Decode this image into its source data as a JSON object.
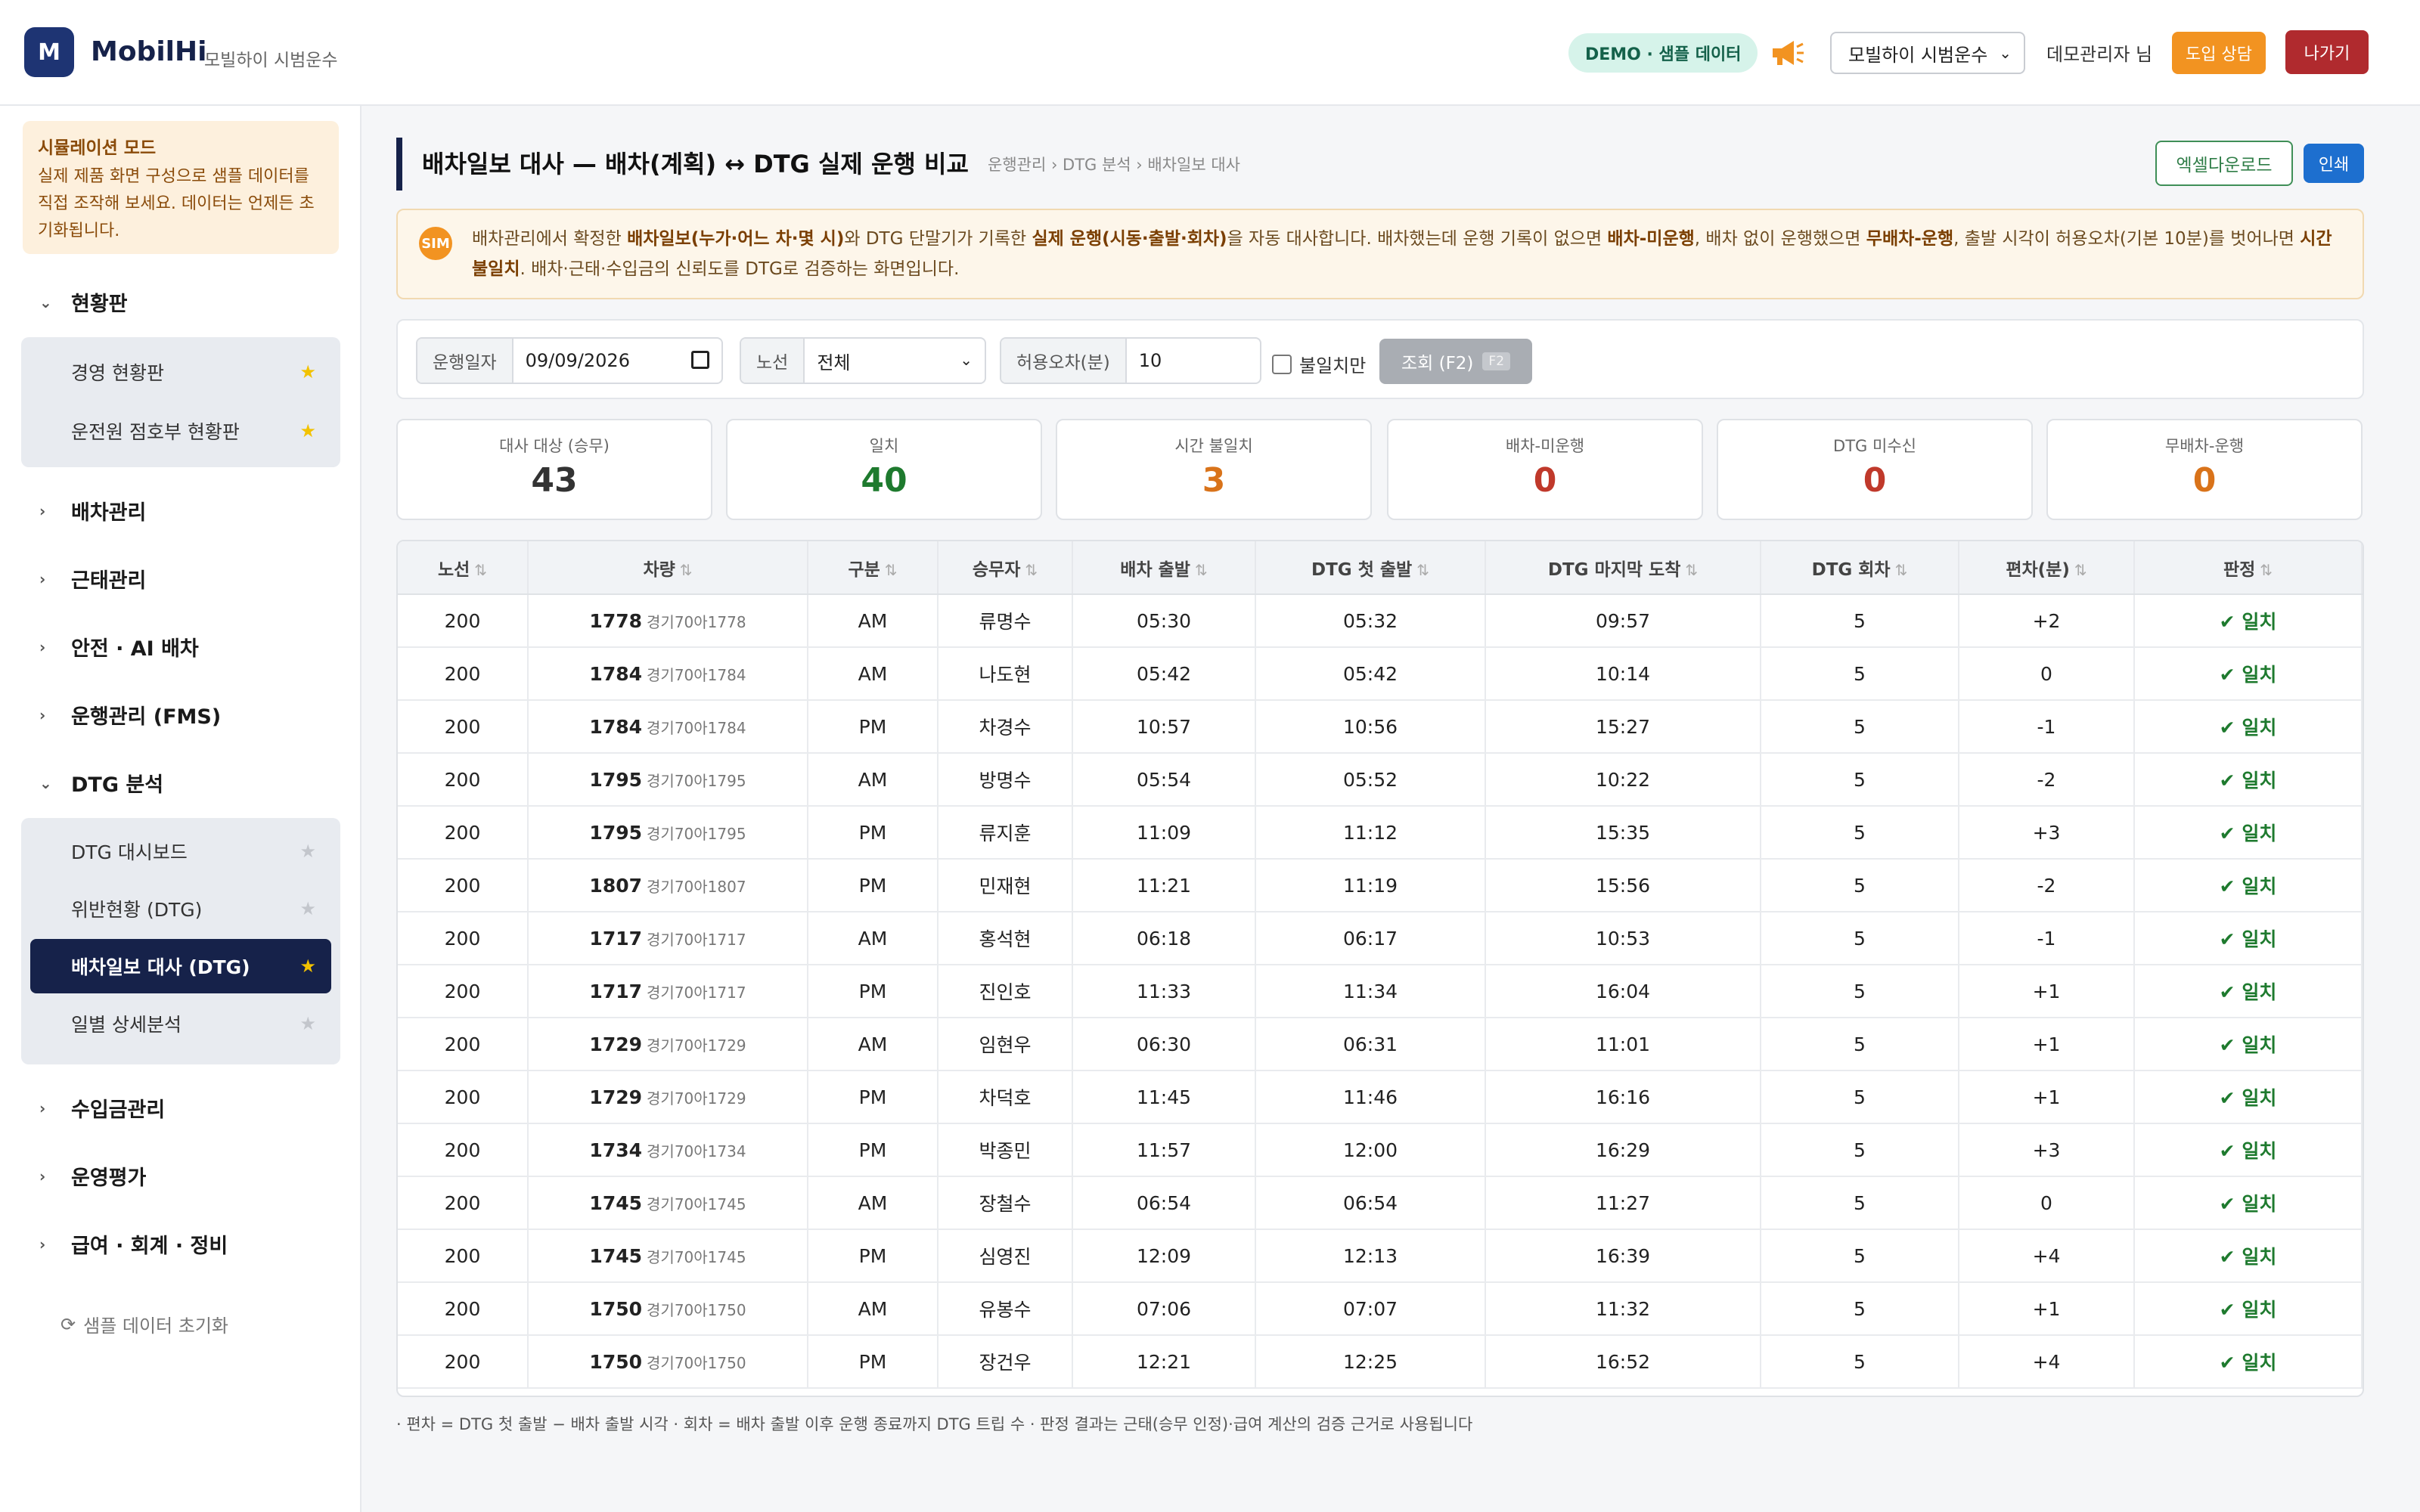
{
  "header": {
    "logo_letter": "M",
    "brand": "MobilHi",
    "brand_sub": "모빌하이 시범운수",
    "demo_badge": "DEMO · 샘플 데이터",
    "org_select": "모빌하이 시범운수",
    "user": "데모관리자 님",
    "consult_label": "도입 상담",
    "exit_label": "나가기"
  },
  "sidebar": {
    "sim_title": "시뮬레이션 모드",
    "sim_text": "실제 제품 화면 구성으로 샘플 데이터를 직접 조작해 보세요. 데이터는 언제든 초기화됩니다.",
    "groups": {
      "dashboard": "현황판",
      "dispatch": "배차관리",
      "attendance": "근태관리",
      "safety": "안전 · AI 배차",
      "fms": "운행관리 (FMS)",
      "dtg": "DTG 분석",
      "revenue": "수입금관리",
      "evaluation": "운영평가",
      "payroll": "급여 · 회계 · 정비"
    },
    "dashboard_items": [
      "경영 현황판",
      "운전원 점호부 현황판"
    ],
    "dtg_items": [
      "DTG 대시보드",
      "위반현황 (DTG)",
      "배차일보 대사 (DTG)",
      "일별 상세분석"
    ],
    "reset_label": "샘플 데이터 초기화"
  },
  "main": {
    "title": "배차일보 대사 — 배차(계획) ↔ DTG 실제 운행 비교",
    "breadcrumb": "운행관리 › DTG 분석 › 배차일보 대사",
    "excel_label": "엑셀다운로드",
    "print_label": "인쇄",
    "sim_badge": "SIM",
    "info": {
      "p1": "배차관리에서 확정한 ",
      "b1": "배차일보(누가·어느 차·몇 시)",
      "p2": "와 DTG 단말기가 기록한 ",
      "b2": "실제 운행(시동·출발·회차)",
      "p3": "을 자동 대사합니다. 배차했는데 운행 기록이 없으면 ",
      "b3": "배차-미운행",
      "p4": ", 배차 없이 운행했으면 ",
      "b4": "무배차-운행",
      "p5": ", 출발 시각이 허용오차(기본 10분)를 벗어나면 ",
      "b5": "시간 불일치",
      "p6": ". 배차·근태·수입금의 신뢰도를 DTG로 검증하는 화면입니다."
    },
    "filters": {
      "date_label": "운행일자",
      "date_value": "09/09/2026",
      "route_label": "노선",
      "route_value": "전체",
      "tolerance_label": "허용오차(분)",
      "tolerance_value": "10",
      "mismatch_only": "불일치만",
      "query_label": "조회 (F2)",
      "query_key": "F2"
    },
    "stats": [
      {
        "label": "대사 대상 (승무)",
        "value": "43",
        "color": "#333333"
      },
      {
        "label": "일치",
        "value": "40",
        "color": "#1e7a2e"
      },
      {
        "label": "시간 불일치",
        "value": "3",
        "color": "#d9731a"
      },
      {
        "label": "배차-미운행",
        "value": "0",
        "color": "#c0392b"
      },
      {
        "label": "DTG 미수신",
        "value": "0",
        "color": "#c0392b"
      },
      {
        "label": "무배차-운행",
        "value": "0",
        "color": "#d9731a"
      }
    ],
    "table": {
      "headers": [
        "노선",
        "차량",
        "구분",
        "승무자",
        "배차 출발",
        "DTG 첫 출발",
        "DTG 마지막 도착",
        "DTG 회차",
        "편차(분)",
        "판정"
      ],
      "sort_icon": "⇅",
      "rows": [
        [
          "200",
          "1778",
          "경기70아1778",
          "AM",
          "류명수",
          "05:30",
          "05:32",
          "09:57",
          "5",
          "+2",
          "✔ 일치"
        ],
        [
          "200",
          "1784",
          "경기70아1784",
          "AM",
          "나도현",
          "05:42",
          "05:42",
          "10:14",
          "5",
          "0",
          "✔ 일치"
        ],
        [
          "200",
          "1784",
          "경기70아1784",
          "PM",
          "차경수",
          "10:57",
          "10:56",
          "15:27",
          "5",
          "-1",
          "✔ 일치"
        ],
        [
          "200",
          "1795",
          "경기70아1795",
          "AM",
          "방명수",
          "05:54",
          "05:52",
          "10:22",
          "5",
          "-2",
          "✔ 일치"
        ],
        [
          "200",
          "1795",
          "경기70아1795",
          "PM",
          "류지훈",
          "11:09",
          "11:12",
          "15:35",
          "5",
          "+3",
          "✔ 일치"
        ],
        [
          "200",
          "1807",
          "경기70아1807",
          "PM",
          "민재현",
          "11:21",
          "11:19",
          "15:56",
          "5",
          "-2",
          "✔ 일치"
        ],
        [
          "200",
          "1717",
          "경기70아1717",
          "AM",
          "홍석현",
          "06:18",
          "06:17",
          "10:53",
          "5",
          "-1",
          "✔ 일치"
        ],
        [
          "200",
          "1717",
          "경기70아1717",
          "PM",
          "진인호",
          "11:33",
          "11:34",
          "16:04",
          "5",
          "+1",
          "✔ 일치"
        ],
        [
          "200",
          "1729",
          "경기70아1729",
          "AM",
          "임현우",
          "06:30",
          "06:31",
          "11:01",
          "5",
          "+1",
          "✔ 일치"
        ],
        [
          "200",
          "1729",
          "경기70아1729",
          "PM",
          "차덕호",
          "11:45",
          "11:46",
          "16:16",
          "5",
          "+1",
          "✔ 일치"
        ],
        [
          "200",
          "1734",
          "경기70아1734",
          "PM",
          "박종민",
          "11:57",
          "12:00",
          "16:29",
          "5",
          "+3",
          "✔ 일치"
        ],
        [
          "200",
          "1745",
          "경기70아1745",
          "AM",
          "장철수",
          "06:54",
          "06:54",
          "11:27",
          "5",
          "0",
          "✔ 일치"
        ],
        [
          "200",
          "1745",
          "경기70아1745",
          "PM",
          "심영진",
          "12:09",
          "12:13",
          "16:39",
          "5",
          "+4",
          "✔ 일치"
        ],
        [
          "200",
          "1750",
          "경기70아1750",
          "AM",
          "유봉수",
          "07:06",
          "07:07",
          "11:32",
          "5",
          "+1",
          "✔ 일치"
        ],
        [
          "200",
          "1750",
          "경기70아1750",
          "PM",
          "장건우",
          "12:21",
          "12:25",
          "16:52",
          "5",
          "+4",
          "✔ 일치"
        ]
      ]
    },
    "footnote": "· 편차 = DTG 첫 출발 − 배차 출발 시각    · 회차 = 배차 출발 이후 운행 종료까지 DTG 트립 수    · 판정 결과는 근태(승무 인정)·급여 계산의 검증 근거로 사용됩니다"
  },
  "colors": {
    "brand": "#16224a",
    "accent_orange": "#f29321",
    "exit_red": "#b02a2e",
    "ok_green": "#1e7a2e"
  },
  "icons": {
    "megaphone": "megaphone-icon",
    "reset": "refresh-icon",
    "star": "star-icon"
  }
}
